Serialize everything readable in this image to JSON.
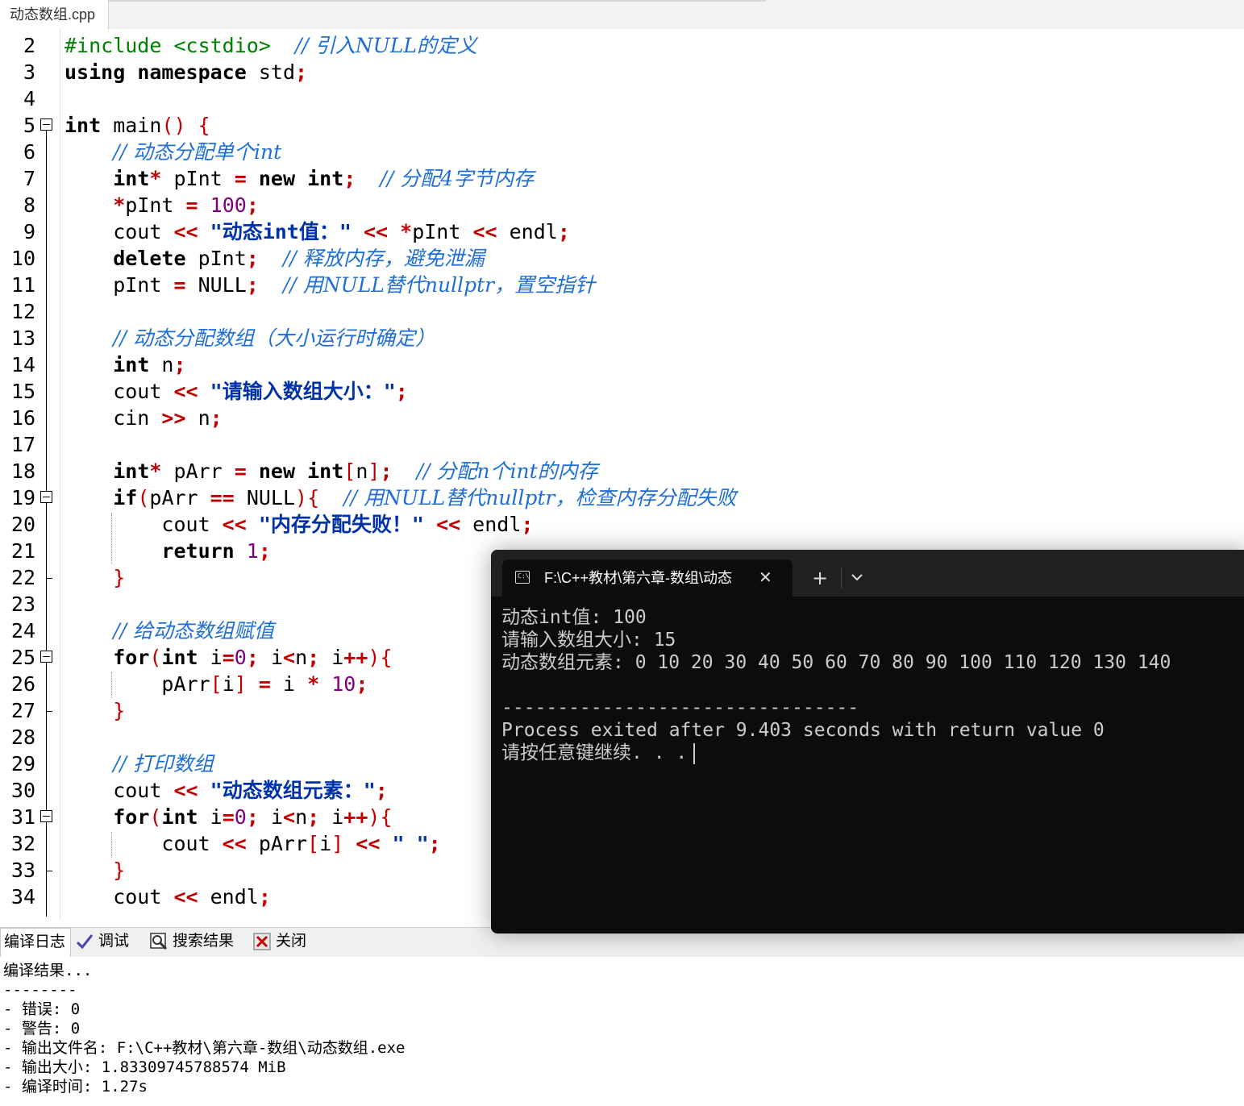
{
  "file_tab": {
    "label": "动态数组.cpp"
  },
  "code_lines": [
    {
      "n": "2",
      "html": "<span class='pp'>#include &lt;cstdio&gt;</span>  <span class='cm'>// 引入NULL的定义</span>"
    },
    {
      "n": "3",
      "html": "<span class='kw'>using</span> <span class='kw'>namespace</span> std<span class='op'>;</span>"
    },
    {
      "n": "4",
      "html": ""
    },
    {
      "n": "5",
      "html": "<span class='kw'>int</span> main<span class='br'>()</span> <span class='br'>{</span>"
    },
    {
      "n": "6",
      "html": "    <span class='cm'>// 动态分配单个int</span>"
    },
    {
      "n": "7",
      "html": "    <span class='kw'>int</span><span class='op'>*</span> pInt <span class='op'>=</span> <span class='kw'>new</span> <span class='kw'>int</span><span class='op'>;</span>  <span class='cm'>// 分配4字节内存</span>"
    },
    {
      "n": "8",
      "html": "    <span class='op'>*</span>pInt <span class='op'>=</span> <span class='nm'>100</span><span class='op'>;</span>"
    },
    {
      "n": "9",
      "html": "    cout <span class='op'>&lt;&lt;</span> <span class='st'>\"动态int值：\"</span> <span class='op'>&lt;&lt;</span> <span class='op'>*</span>pInt <span class='op'>&lt;&lt;</span> endl<span class='op'>;</span>"
    },
    {
      "n": "10",
      "html": "    <span class='kw'>delete</span> pInt<span class='op'>;</span>  <span class='cm'>// 释放内存，避免泄漏</span>"
    },
    {
      "n": "11",
      "html": "    pInt <span class='op'>=</span> NULL<span class='op'>;</span>  <span class='cm'>// 用NULL替代nullptr，置空指针</span>"
    },
    {
      "n": "12",
      "html": ""
    },
    {
      "n": "13",
      "html": "    <span class='cm'>// 动态分配数组（大小运行时确定）</span>"
    },
    {
      "n": "14",
      "html": "    <span class='kw'>int</span> n<span class='op'>;</span>"
    },
    {
      "n": "15",
      "html": "    cout <span class='op'>&lt;&lt;</span> <span class='st'>\"请输入数组大小：\"</span><span class='op'>;</span>"
    },
    {
      "n": "16",
      "html": "    cin <span class='op'>&gt;&gt;</span> n<span class='op'>;</span>"
    },
    {
      "n": "17",
      "html": ""
    },
    {
      "n": "18",
      "html": "    <span class='kw'>int</span><span class='op'>*</span> pArr <span class='op'>=</span> <span class='kw'>new</span> <span class='kw'>int</span><span class='br'>[</span>n<span class='br'>]</span><span class='op'>;</span>  <span class='cm'>// 分配n个int的内存</span>"
    },
    {
      "n": "19",
      "html": "    <span class='kw'>if</span><span class='br'>(</span>pArr <span class='op'>==</span> NULL<span class='br'>){</span>  <span class='cm'>// 用NULL替代nullptr，检查内存分配失败</span>"
    },
    {
      "n": "20",
      "html": "        cout <span class='op'>&lt;&lt;</span> <span class='st'>\"内存分配失败！\"</span> <span class='op'>&lt;&lt;</span> endl<span class='op'>;</span>"
    },
    {
      "n": "21",
      "html": "        <span class='kw'>return</span> <span class='nm'>1</span><span class='op'>;</span>"
    },
    {
      "n": "22",
      "html": "    <span class='br'>}</span>"
    },
    {
      "n": "23",
      "html": ""
    },
    {
      "n": "24",
      "html": "    <span class='cm'>// 给动态数组赋值</span>"
    },
    {
      "n": "25",
      "html": "    <span class='kw'>for</span><span class='br'>(</span><span class='kw'>int</span> i<span class='op'>=</span><span class='nm'>0</span><span class='op'>;</span> i<span class='op'>&lt;</span>n<span class='op'>;</span> i<span class='op'>++</span><span class='br'>){</span>"
    },
    {
      "n": "26",
      "html": "        pArr<span class='br'>[</span>i<span class='br'>]</span> <span class='op'>=</span> i <span class='op'>*</span> <span class='nm'>10</span><span class='op'>;</span>"
    },
    {
      "n": "27",
      "html": "    <span class='br'>}</span>"
    },
    {
      "n": "28",
      "html": ""
    },
    {
      "n": "29",
      "html": "    <span class='cm'>// 打印数组</span>"
    },
    {
      "n": "30",
      "html": "    cout <span class='op'>&lt;&lt;</span> <span class='st'>\"动态数组元素：\"</span><span class='op'>;</span>"
    },
    {
      "n": "31",
      "html": "    <span class='kw'>for</span><span class='br'>(</span><span class='kw'>int</span> i<span class='op'>=</span><span class='nm'>0</span><span class='op'>;</span> i<span class='op'>&lt;</span>n<span class='op'>;</span> i<span class='op'>++</span><span class='br'>){</span>"
    },
    {
      "n": "32",
      "html": "        cout <span class='op'>&lt;&lt;</span> pArr<span class='br'>[</span>i<span class='br'>]</span> <span class='op'>&lt;&lt;</span> <span class='st'>\" \"</span><span class='op'>;</span>"
    },
    {
      "n": "33",
      "html": "    <span class='br'>}</span>"
    },
    {
      "n": "34",
      "html": "    cout <span class='op'>&lt;&lt;</span> endl<span class='op'>;</span>"
    }
  ],
  "bottom_tabs": [
    {
      "label": "编译日志"
    },
    {
      "label": "调试"
    },
    {
      "label": "搜索结果"
    },
    {
      "label": "关闭"
    }
  ],
  "compile_log": [
    "编译结果...",
    "--------",
    "- 错误: 0",
    "- 警告: 0",
    "- 输出文件名: F:\\C++教材\\第六章-数组\\动态数组.exe",
    "- 输出大小: 1.83309745788574 MiB",
    "- 编译时间: 1.27s"
  ],
  "terminal": {
    "tab_title": "F:\\C++教材\\第六章-数组\\动态",
    "new_tab": "+",
    "lines": [
      "动态int值: 100",
      "请输入数组大小: 15",
      "动态数组元素: 0 10 20 30 40 50 60 70 80 90 100 110 120 130 140",
      "",
      "--------------------------------",
      "Process exited after 9.403 seconds with return value 0",
      "请按任意键继续. . ."
    ]
  }
}
